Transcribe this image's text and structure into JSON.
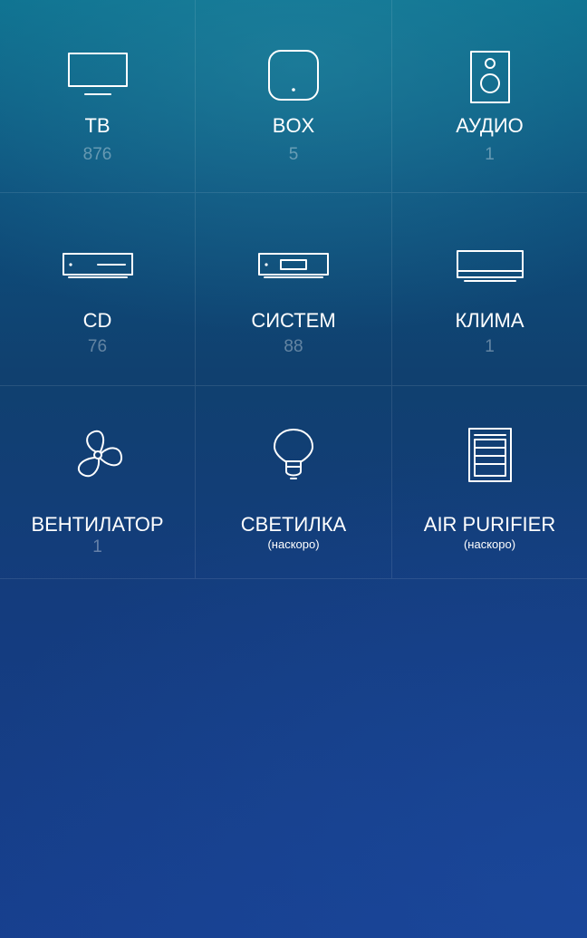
{
  "devices": [
    {
      "label": "ТВ",
      "count": "876",
      "icon": "tv-icon"
    },
    {
      "label": "BOX",
      "count": "5",
      "icon": "set-top-box-icon"
    },
    {
      "label": "АУДИО",
      "count": "1",
      "icon": "speaker-icon"
    },
    {
      "label": "CD",
      "count": "76",
      "icon": "cd-player-icon"
    },
    {
      "label": "СИСТЕМ",
      "count": "88",
      "icon": "stereo-system-icon"
    },
    {
      "label": "КЛИМА",
      "count": "1",
      "icon": "air-conditioner-icon"
    },
    {
      "label": "ВЕНТИЛАТОР",
      "count": "1",
      "icon": "fan-icon"
    },
    {
      "label": "СВЕТИЛКА",
      "note": "(наскоро)",
      "icon": "light-bulb-icon"
    },
    {
      "label": "AIR PURIFIER",
      "note": "(наскоро)",
      "icon": "air-purifier-icon"
    }
  ],
  "colors": {
    "background_top": "#0b6f8e",
    "background_bottom": "#173f8e",
    "text": "#ffffff",
    "count_text": "rgba(255,255,255,0.35)"
  }
}
